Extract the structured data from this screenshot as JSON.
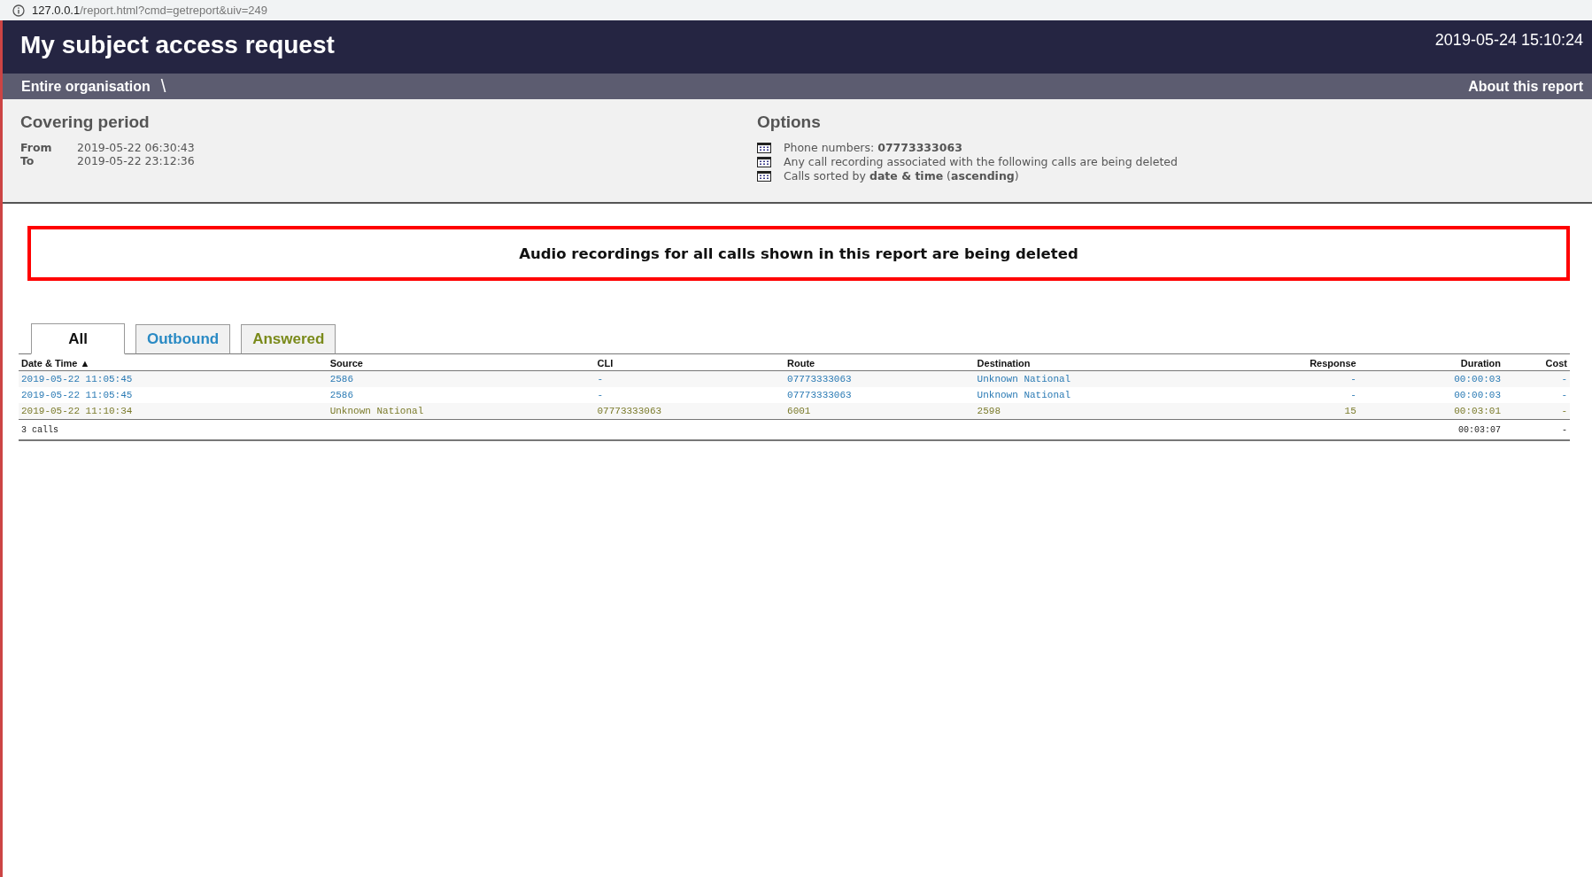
{
  "address_bar": {
    "host": "127.0.0.1",
    "path": "/report.html?cmd=getreport&uiv=249"
  },
  "header": {
    "title": "My subject access request",
    "timestamp": "2019-05-24 15:10:24"
  },
  "breadcrumb": {
    "items": [
      "Entire organisation"
    ],
    "separator": "\\",
    "about_link": "About this report"
  },
  "covering_period": {
    "heading": "Covering period",
    "rows": [
      {
        "label": "From",
        "value": "2019-05-22 06:30:43"
      },
      {
        "label": "To",
        "value": "2019-05-22 23:12:36"
      }
    ]
  },
  "options": {
    "heading": "Options",
    "items": [
      "Phone numbers: **07773333063**",
      "Any call recording associated with the following calls are being deleted",
      "Calls sorted by **date & time** (**ascending**)"
    ]
  },
  "alert": "Audio recordings for all calls shown in this report are being deleted",
  "tabs": [
    {
      "label": "All",
      "kind": "all",
      "selected": true
    },
    {
      "label": "Outbound",
      "kind": "outbound",
      "selected": false
    },
    {
      "label": "Answered",
      "kind": "answered",
      "selected": false
    }
  ],
  "table": {
    "columns": [
      "Date & Time ▲",
      "Source",
      "CLI",
      "Route",
      "Destination",
      "Response",
      "Duration",
      "Cost"
    ],
    "rows": [
      {
        "kind": "outbound",
        "cells": [
          "2019-05-22 11:05:45",
          "2586",
          "-",
          "07773333063",
          "Unknown National",
          "-",
          "00:00:03",
          "-"
        ]
      },
      {
        "kind": "outbound",
        "cells": [
          "2019-05-22 11:05:45",
          "2586",
          "-",
          "07773333063",
          "Unknown National",
          "-",
          "00:00:03",
          "-"
        ]
      },
      {
        "kind": "answered",
        "cells": [
          "2019-05-22 11:10:34",
          "Unknown National",
          "07773333063",
          "6001",
          "2598",
          "15",
          "00:03:01",
          "-"
        ]
      }
    ],
    "footer": {
      "count": "3 calls",
      "duration": "00:03:07",
      "cost": "-"
    }
  }
}
